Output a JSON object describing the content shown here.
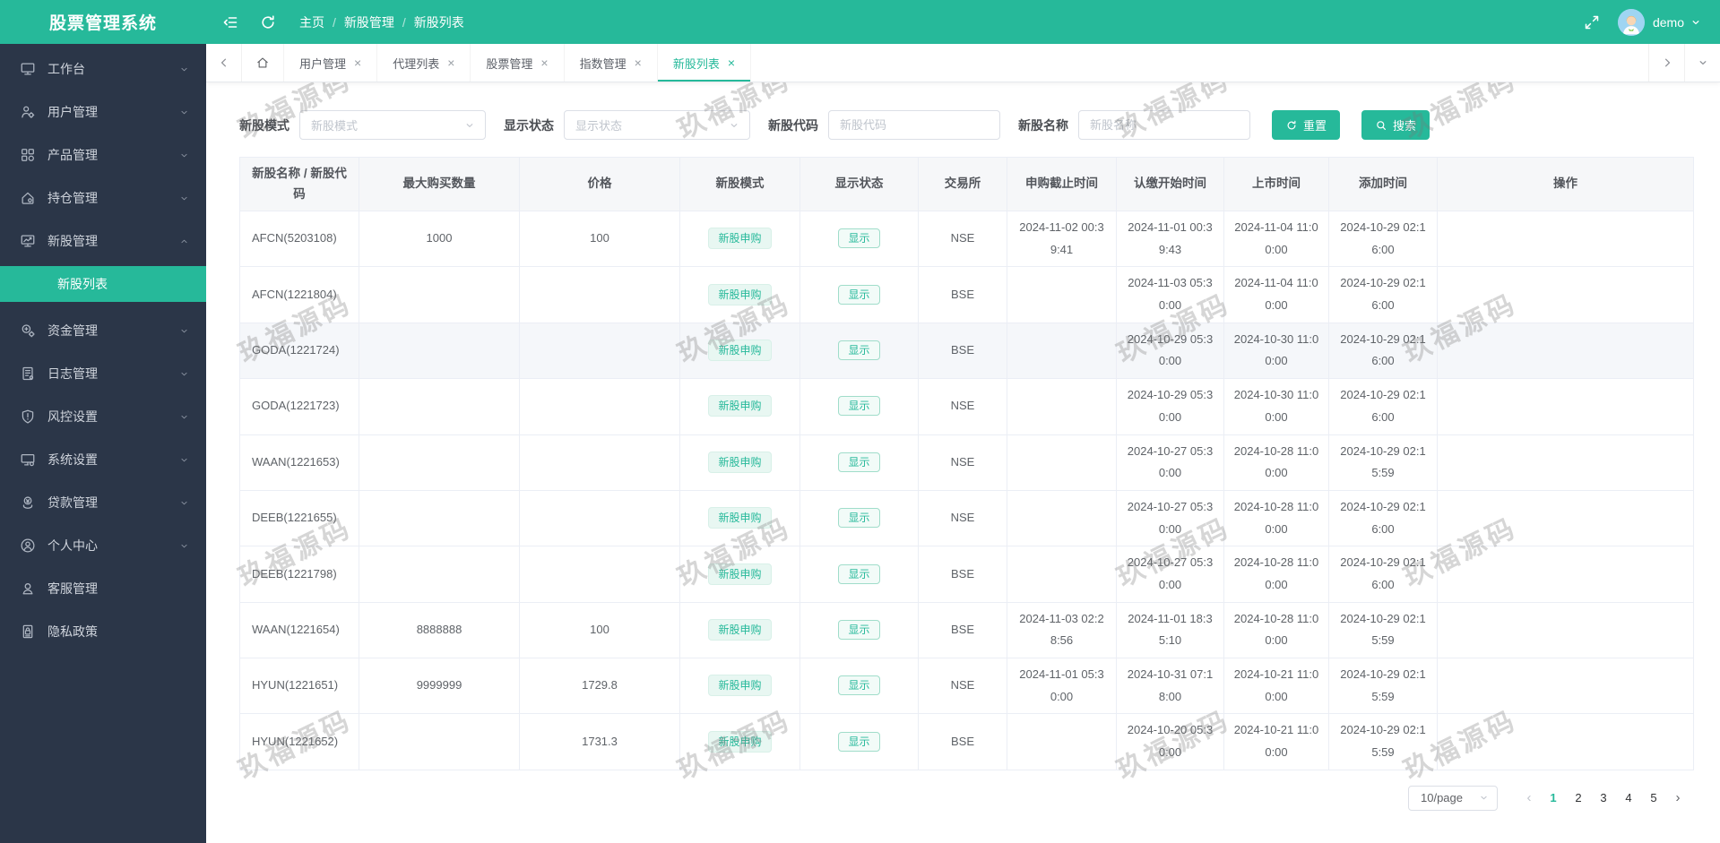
{
  "app": {
    "title": "股票管理系统"
  },
  "header": {
    "breadcrumb": [
      "主页",
      "新股管理",
      "新股列表"
    ],
    "user": "demo"
  },
  "sidebar": {
    "items": [
      {
        "key": "workbench",
        "label": "工作台",
        "icon": "monitor",
        "arrow": "down"
      },
      {
        "key": "user-management",
        "label": "用户管理",
        "icon": "user-gear",
        "arrow": "down"
      },
      {
        "key": "product-management",
        "label": "产品管理",
        "icon": "grid",
        "arrow": "down"
      },
      {
        "key": "position-management",
        "label": "持仓管理",
        "icon": "home-gear",
        "arrow": "down"
      },
      {
        "key": "ipo-management",
        "label": "新股管理",
        "icon": "chart-monitor",
        "arrow": "up",
        "children": [
          {
            "key": "ipo-list",
            "label": "新股列表",
            "active": true
          }
        ]
      },
      {
        "key": "funds-management",
        "label": "资金管理",
        "icon": "money-gear",
        "arrow": "down"
      },
      {
        "key": "log-management",
        "label": "日志管理",
        "icon": "notebook",
        "arrow": "down"
      },
      {
        "key": "risk-settings",
        "label": "风控设置",
        "icon": "shield-alert",
        "arrow": "down"
      },
      {
        "key": "system-settings",
        "label": "系统设置",
        "icon": "monitor-gear",
        "arrow": "down"
      },
      {
        "key": "loan-management",
        "label": "贷款管理",
        "icon": "loan",
        "arrow": "down"
      },
      {
        "key": "personal-center",
        "label": "个人中心",
        "icon": "person-circle",
        "arrow": "down"
      },
      {
        "key": "customer-service",
        "label": "客服管理",
        "icon": "headset",
        "arrow": null
      },
      {
        "key": "privacy-policy",
        "label": "隐私政策",
        "icon": "privacy-lock",
        "arrow": null
      }
    ]
  },
  "tabs": {
    "items": [
      {
        "key": "home",
        "label": "",
        "closable": false,
        "icon": "home"
      },
      {
        "key": "user-management",
        "label": "用户管理",
        "closable": true
      },
      {
        "key": "agent-list",
        "label": "代理列表",
        "closable": true
      },
      {
        "key": "stock-management",
        "label": "股票管理",
        "closable": true
      },
      {
        "key": "index-management",
        "label": "指数管理",
        "closable": true
      },
      {
        "key": "ipo-list",
        "label": "新股列表",
        "closable": true,
        "active": true
      }
    ]
  },
  "filters": {
    "mode": {
      "label": "新股模式",
      "placeholder": "新股模式"
    },
    "status": {
      "label": "显示状态",
      "placeholder": "显示状态"
    },
    "code": {
      "label": "新股代码",
      "placeholder": "新股代码",
      "value": ""
    },
    "name": {
      "label": "新股名称",
      "placeholder": "新股名称",
      "value": ""
    },
    "reset_label": "重置",
    "search_label": "搜索"
  },
  "table": {
    "columns": [
      "新股名称 / 新股代码",
      "最大购买数量",
      "价格",
      "新股模式",
      "显示状态",
      "交易所",
      "申购截止时间",
      "认缴开始时间",
      "上市时间",
      "添加时间",
      "操作"
    ],
    "rows": [
      {
        "name": "AFCN(5203108)",
        "max_qty": "1000",
        "price": "100",
        "mode": "新股申购",
        "status": "显示",
        "exchange": "NSE",
        "purchase_deadline": "2024-11-02 00:39:41",
        "subscribe_start": "2024-11-01 00:39:43",
        "listing_time": "2024-11-04 11:00:00",
        "added_time": "2024-10-29 02:16:00"
      },
      {
        "name": "AFCN(1221804)",
        "max_qty": "",
        "price": "",
        "mode": "新股申购",
        "status": "显示",
        "exchange": "BSE",
        "purchase_deadline": "",
        "subscribe_start": "2024-11-03 05:30:00",
        "listing_time": "2024-11-04 11:00:00",
        "added_time": "2024-10-29 02:16:00"
      },
      {
        "name": "GODA(1221724)",
        "max_qty": "",
        "price": "",
        "mode": "新股申购",
        "status": "显示",
        "exchange": "BSE",
        "purchase_deadline": "",
        "subscribe_start": "2024-10-29 05:30:00",
        "listing_time": "2024-10-30 11:00:00",
        "added_time": "2024-10-29 02:16:00"
      },
      {
        "name": "GODA(1221723)",
        "max_qty": "",
        "price": "",
        "mode": "新股申购",
        "status": "显示",
        "exchange": "NSE",
        "purchase_deadline": "",
        "subscribe_start": "2024-10-29 05:30:00",
        "listing_time": "2024-10-30 11:00:00",
        "added_time": "2024-10-29 02:16:00"
      },
      {
        "name": "WAAN(1221653)",
        "max_qty": "",
        "price": "",
        "mode": "新股申购",
        "status": "显示",
        "exchange": "NSE",
        "purchase_deadline": "",
        "subscribe_start": "2024-10-27 05:30:00",
        "listing_time": "2024-10-28 11:00:00",
        "added_time": "2024-10-29 02:15:59"
      },
      {
        "name": "DEEB(1221655)",
        "max_qty": "",
        "price": "",
        "mode": "新股申购",
        "status": "显示",
        "exchange": "NSE",
        "purchase_deadline": "",
        "subscribe_start": "2024-10-27 05:30:00",
        "listing_time": "2024-10-28 11:00:00",
        "added_time": "2024-10-29 02:16:00"
      },
      {
        "name": "DEEB(1221798)",
        "max_qty": "",
        "price": "",
        "mode": "新股申购",
        "status": "显示",
        "exchange": "BSE",
        "purchase_deadline": "",
        "subscribe_start": "2024-10-27 05:30:00",
        "listing_time": "2024-10-28 11:00:00",
        "added_time": "2024-10-29 02:16:00"
      },
      {
        "name": "WAAN(1221654)",
        "max_qty": "8888888",
        "price": "100",
        "mode": "新股申购",
        "status": "显示",
        "exchange": "BSE",
        "purchase_deadline": "2024-11-03 02:28:56",
        "subscribe_start": "2024-11-01 18:35:10",
        "listing_time": "2024-10-28 11:00:00",
        "added_time": "2024-10-29 02:15:59"
      },
      {
        "name": "HYUN(1221651)",
        "max_qty": "9999999",
        "price": "1729.8",
        "mode": "新股申购",
        "status": "显示",
        "exchange": "NSE",
        "purchase_deadline": "2024-11-01 05:30:00",
        "subscribe_start": "2024-10-31 07:18:00",
        "listing_time": "2024-10-21 11:00:00",
        "added_time": "2024-10-29 02:15:59"
      },
      {
        "name": "HYUN(1221652)",
        "max_qty": "",
        "price": "1731.3",
        "mode": "新股申购",
        "status": "显示",
        "exchange": "BSE",
        "purchase_deadline": "",
        "subscribe_start": "2024-10-20 05:30:00",
        "listing_time": "2024-10-21 11:00:00",
        "added_time": "2024-10-29 02:15:59"
      }
    ]
  },
  "pagination": {
    "page_size": "10/page",
    "pages": [
      1,
      2,
      3,
      4,
      5
    ],
    "active_page": 1
  },
  "watermark": {
    "text": "玖福源码"
  },
  "colors": {
    "primary": "#26b99a",
    "sidebar_bg": "#2b3648"
  }
}
